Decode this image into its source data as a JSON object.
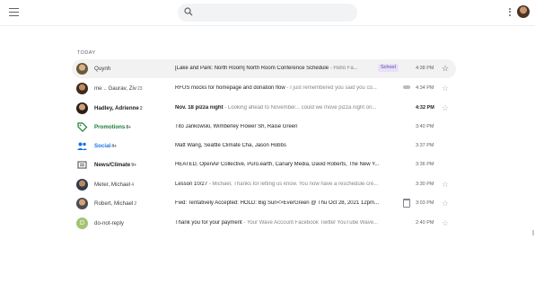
{
  "search": {
    "placeholder": ""
  },
  "inbox": {
    "section_label": "TODAY",
    "rows": [
      {
        "sender": "Quynh",
        "count": "",
        "subject": "[Lake and Park: North Room] North Room Conference Schedule",
        "snippet": " - Hello Fa...",
        "label": "School",
        "time": "4:38 PM"
      },
      {
        "sender": "me .. Gaurav, Ziv",
        "count": "23",
        "subject": "RFUS mocks for homepage and donation flow",
        "snippet": " - I just remembered you said you co...",
        "label": "",
        "time": "4:34 PM"
      },
      {
        "sender": "Hadley, Adrienne",
        "count": "2",
        "subject": "Nov. 18 pizza night",
        "snippet": " - Looking ahead to November... could we move pizza night on...",
        "label": "",
        "time": "4:32 PM"
      },
      {
        "sender": "Promotions",
        "count": "8+",
        "subject": "Tito Jankowski, Wimberley Flower Sh, Raise Green",
        "snippet": "",
        "label": "",
        "time": "3:40 PM"
      },
      {
        "sender": "Social",
        "count": "4+",
        "subject": "Matt Wang, Seattle Climate Cha, Jason Hobbs",
        "snippet": "",
        "label": "",
        "time": "3:37 PM"
      },
      {
        "sender": "News/Climate",
        "count": "9+",
        "subject": "HEATED, OpenAir Collective, Puro.earth, Canary Media, David Roberts, The New Y...",
        "snippet": "",
        "label": "",
        "time": "3:36 PM"
      },
      {
        "sender": "Meter, Michael",
        "count": "4",
        "subject": "Lesson 10/27",
        "snippet": " - Michael, Thanks for letting us know. You now have a reschedule cre...",
        "label": "",
        "time": "3:30 PM"
      },
      {
        "sender": "Robert, Michael",
        "count": "2",
        "subject": "Fwd: Tentatively Accepted: HOLD: Big Sun<>EverGreen @ Thu Oct 28, 2021 12pm...",
        "snippet": "",
        "label": "",
        "time": "3:03 PM"
      },
      {
        "sender": "do-not-reply",
        "count": "",
        "subject": "Thank you for your payment",
        "snippet": " - Your Wave Account Facebook Twitter YouTube Wave...",
        "label": "",
        "time": "2:40 PM"
      }
    ]
  },
  "icons": {
    "menu": "hamburger-menu-icon",
    "search": "search-icon",
    "more": "more-vert-icon",
    "promotions": "tag-icon",
    "social": "people-icon",
    "news": "newspaper-icon",
    "star": "star-icon"
  },
  "colors": {
    "promotions": "#188038",
    "social": "#1a73e8",
    "label_chip": "#e8e0f6"
  }
}
